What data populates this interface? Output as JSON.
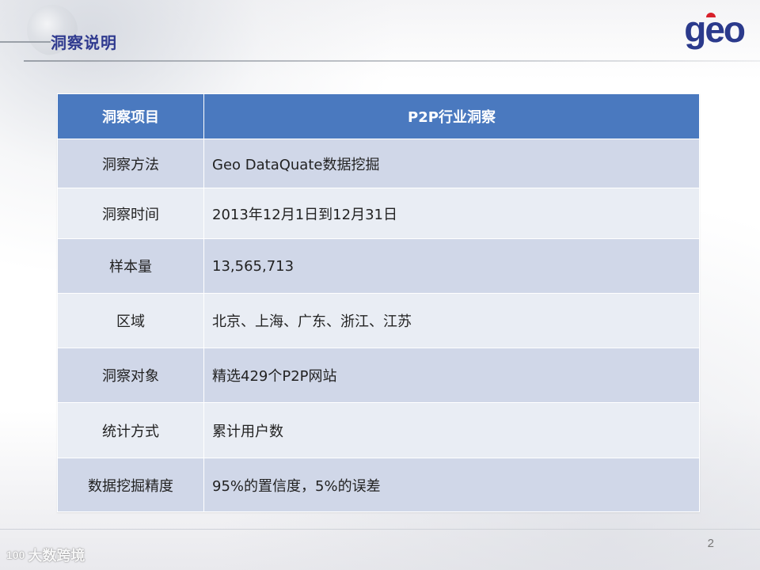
{
  "header": {
    "title": "洞察说明",
    "logo_text": "geo"
  },
  "table": {
    "header": {
      "label": "洞察项目",
      "value": "P2P行业洞察"
    },
    "rows": [
      {
        "label": "洞察方法",
        "value": "Geo  DataQuate数据挖掘"
      },
      {
        "label": "洞察时间",
        "value": "2013年12月1日到12月31日"
      },
      {
        "label": "样本量",
        "value": "13,565,713"
      },
      {
        "label": "区域",
        "value": "北京、上海、广东、浙江、江苏"
      },
      {
        "label": "洞察对象",
        "value": "精选429个P2P网站"
      },
      {
        "label": "统计方式",
        "value": "累计用户数"
      },
      {
        "label": "数据挖掘精度",
        "value": "95%的置信度，5%的误差"
      }
    ]
  },
  "footer": {
    "page_number": "2",
    "watermark_text": "大数跨境",
    "watermark_icon": "100"
  },
  "colors": {
    "header_row": "#4a79bf",
    "row_dark": "#d0d7e8",
    "row_light": "#e9edf4",
    "title": "#2f3a8f",
    "logo": "#2b3a8c"
  }
}
